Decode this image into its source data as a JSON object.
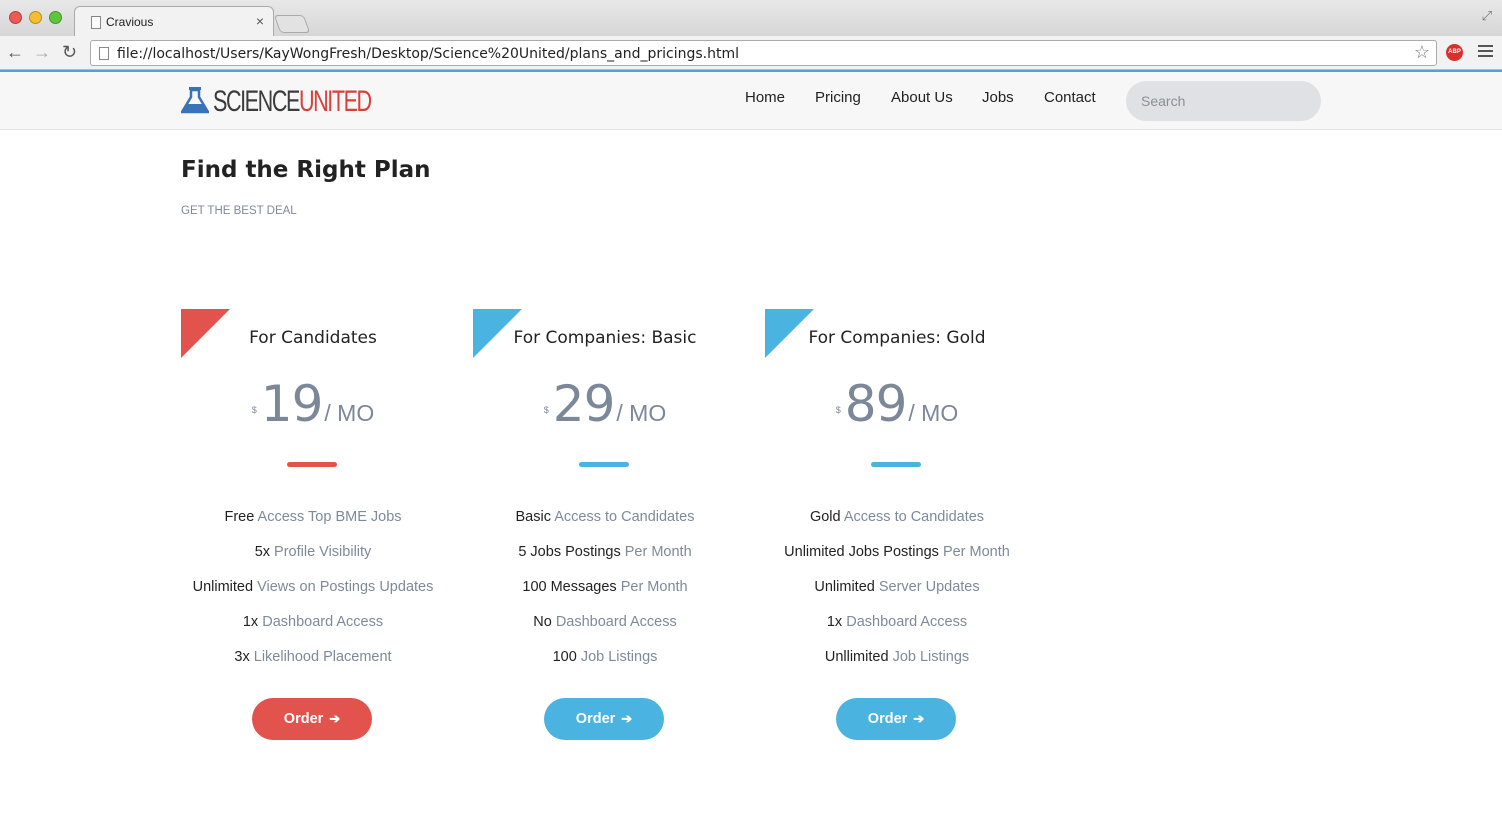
{
  "browser": {
    "tab_title": "Cravious",
    "tab_close": "×",
    "url": "file://localhost/Users/KayWongFresh/Desktop/Science%20United/plans_and_pricings.html",
    "abp_label": "ABP"
  },
  "site": {
    "logo_part1": "SCIENCE",
    "logo_part2": "UNITED",
    "nav": [
      "Home",
      "Pricing",
      "About Us",
      "Jobs",
      "Contact"
    ],
    "search_placeholder": "Search"
  },
  "page": {
    "title": "Find the Right Plan",
    "subtitle": "GET THE BEST DEAL"
  },
  "colors": {
    "red": "#e2534e",
    "blue": "#4ab3e0"
  },
  "plans": [
    {
      "name": "For Candidates",
      "currency": "$",
      "amount": "19",
      "period": "/ MO",
      "accent": "red",
      "features": [
        {
          "strong": "Free",
          "light": "Access Top BME Jobs"
        },
        {
          "strong": "5x",
          "light": "Profile Visibility"
        },
        {
          "strong": "Unlimited",
          "light": "Views on Postings Updates"
        },
        {
          "strong": "1x",
          "light": "Dashboard Access"
        },
        {
          "strong": "3x",
          "light": "Likelihood Placement"
        }
      ],
      "button": "Order"
    },
    {
      "name": "For Companies: Basic",
      "currency": "$",
      "amount": "29",
      "period": "/ MO",
      "accent": "blue",
      "features": [
        {
          "strong": "Basic",
          "light": "Access to Candidates"
        },
        {
          "strong": "5 Jobs Postings",
          "light": "Per Month"
        },
        {
          "strong": "100 Messages",
          "light": "Per Month"
        },
        {
          "strong": "No",
          "light": "Dashboard Access"
        },
        {
          "strong": "100",
          "light": "Job Listings"
        }
      ],
      "button": "Order"
    },
    {
      "name": "For Companies: Gold",
      "currency": "$",
      "amount": "89",
      "period": "/ MO",
      "accent": "blue",
      "features": [
        {
          "strong": "Gold",
          "light": "Access to Candidates"
        },
        {
          "strong": "Unlimited Jobs Postings",
          "light": "Per Month"
        },
        {
          "strong": "Unlimited",
          "light": "Server Updates"
        },
        {
          "strong": "1x",
          "light": "Dashboard Access"
        },
        {
          "strong": "Unllimited",
          "light": "Job Listings"
        }
      ],
      "button": "Order"
    }
  ]
}
